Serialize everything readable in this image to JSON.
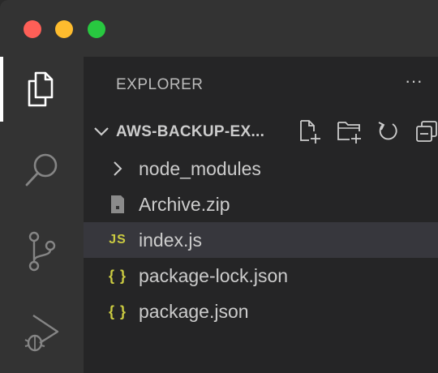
{
  "window": {
    "traffic_lights": {
      "close": "#fe5f57",
      "minimize": "#febc2e",
      "zoom": "#28c840"
    }
  },
  "activity_bar": {
    "items": [
      {
        "name": "explorer",
        "icon": "files-icon",
        "active": true
      },
      {
        "name": "search",
        "icon": "search-icon",
        "active": false
      },
      {
        "name": "source-control",
        "icon": "source-control-icon",
        "active": false
      },
      {
        "name": "run-debug",
        "icon": "run-debug-icon",
        "active": false
      }
    ]
  },
  "sidebar": {
    "title": "EXPLORER",
    "more_label": "···",
    "section": {
      "title": "AWS-BACKUP-EX...",
      "actions": [
        "new-file-icon",
        "new-folder-icon",
        "refresh-icon",
        "collapse-all-icon"
      ]
    },
    "tree": [
      {
        "label": "node_modules",
        "icon": "chevron-right-icon",
        "type": "folder",
        "selected": false
      },
      {
        "label": "Archive.zip",
        "icon": "zip-file-icon",
        "type": "file",
        "selected": false
      },
      {
        "label": "index.js",
        "icon": "js-file-icon",
        "badge": "JS",
        "type": "file",
        "selected": true
      },
      {
        "label": "package-lock.json",
        "icon": "json-file-icon",
        "badge": "{ }",
        "type": "file",
        "selected": false
      },
      {
        "label": "package.json",
        "icon": "json-file-icon",
        "badge": "{ }",
        "type": "file",
        "selected": false
      }
    ]
  },
  "colors": {
    "activity_bar": "#333333",
    "sidebar": "#252526",
    "selected_row": "#37373d",
    "text": "#cccccc",
    "json_js_accent": "#cbcb41"
  }
}
